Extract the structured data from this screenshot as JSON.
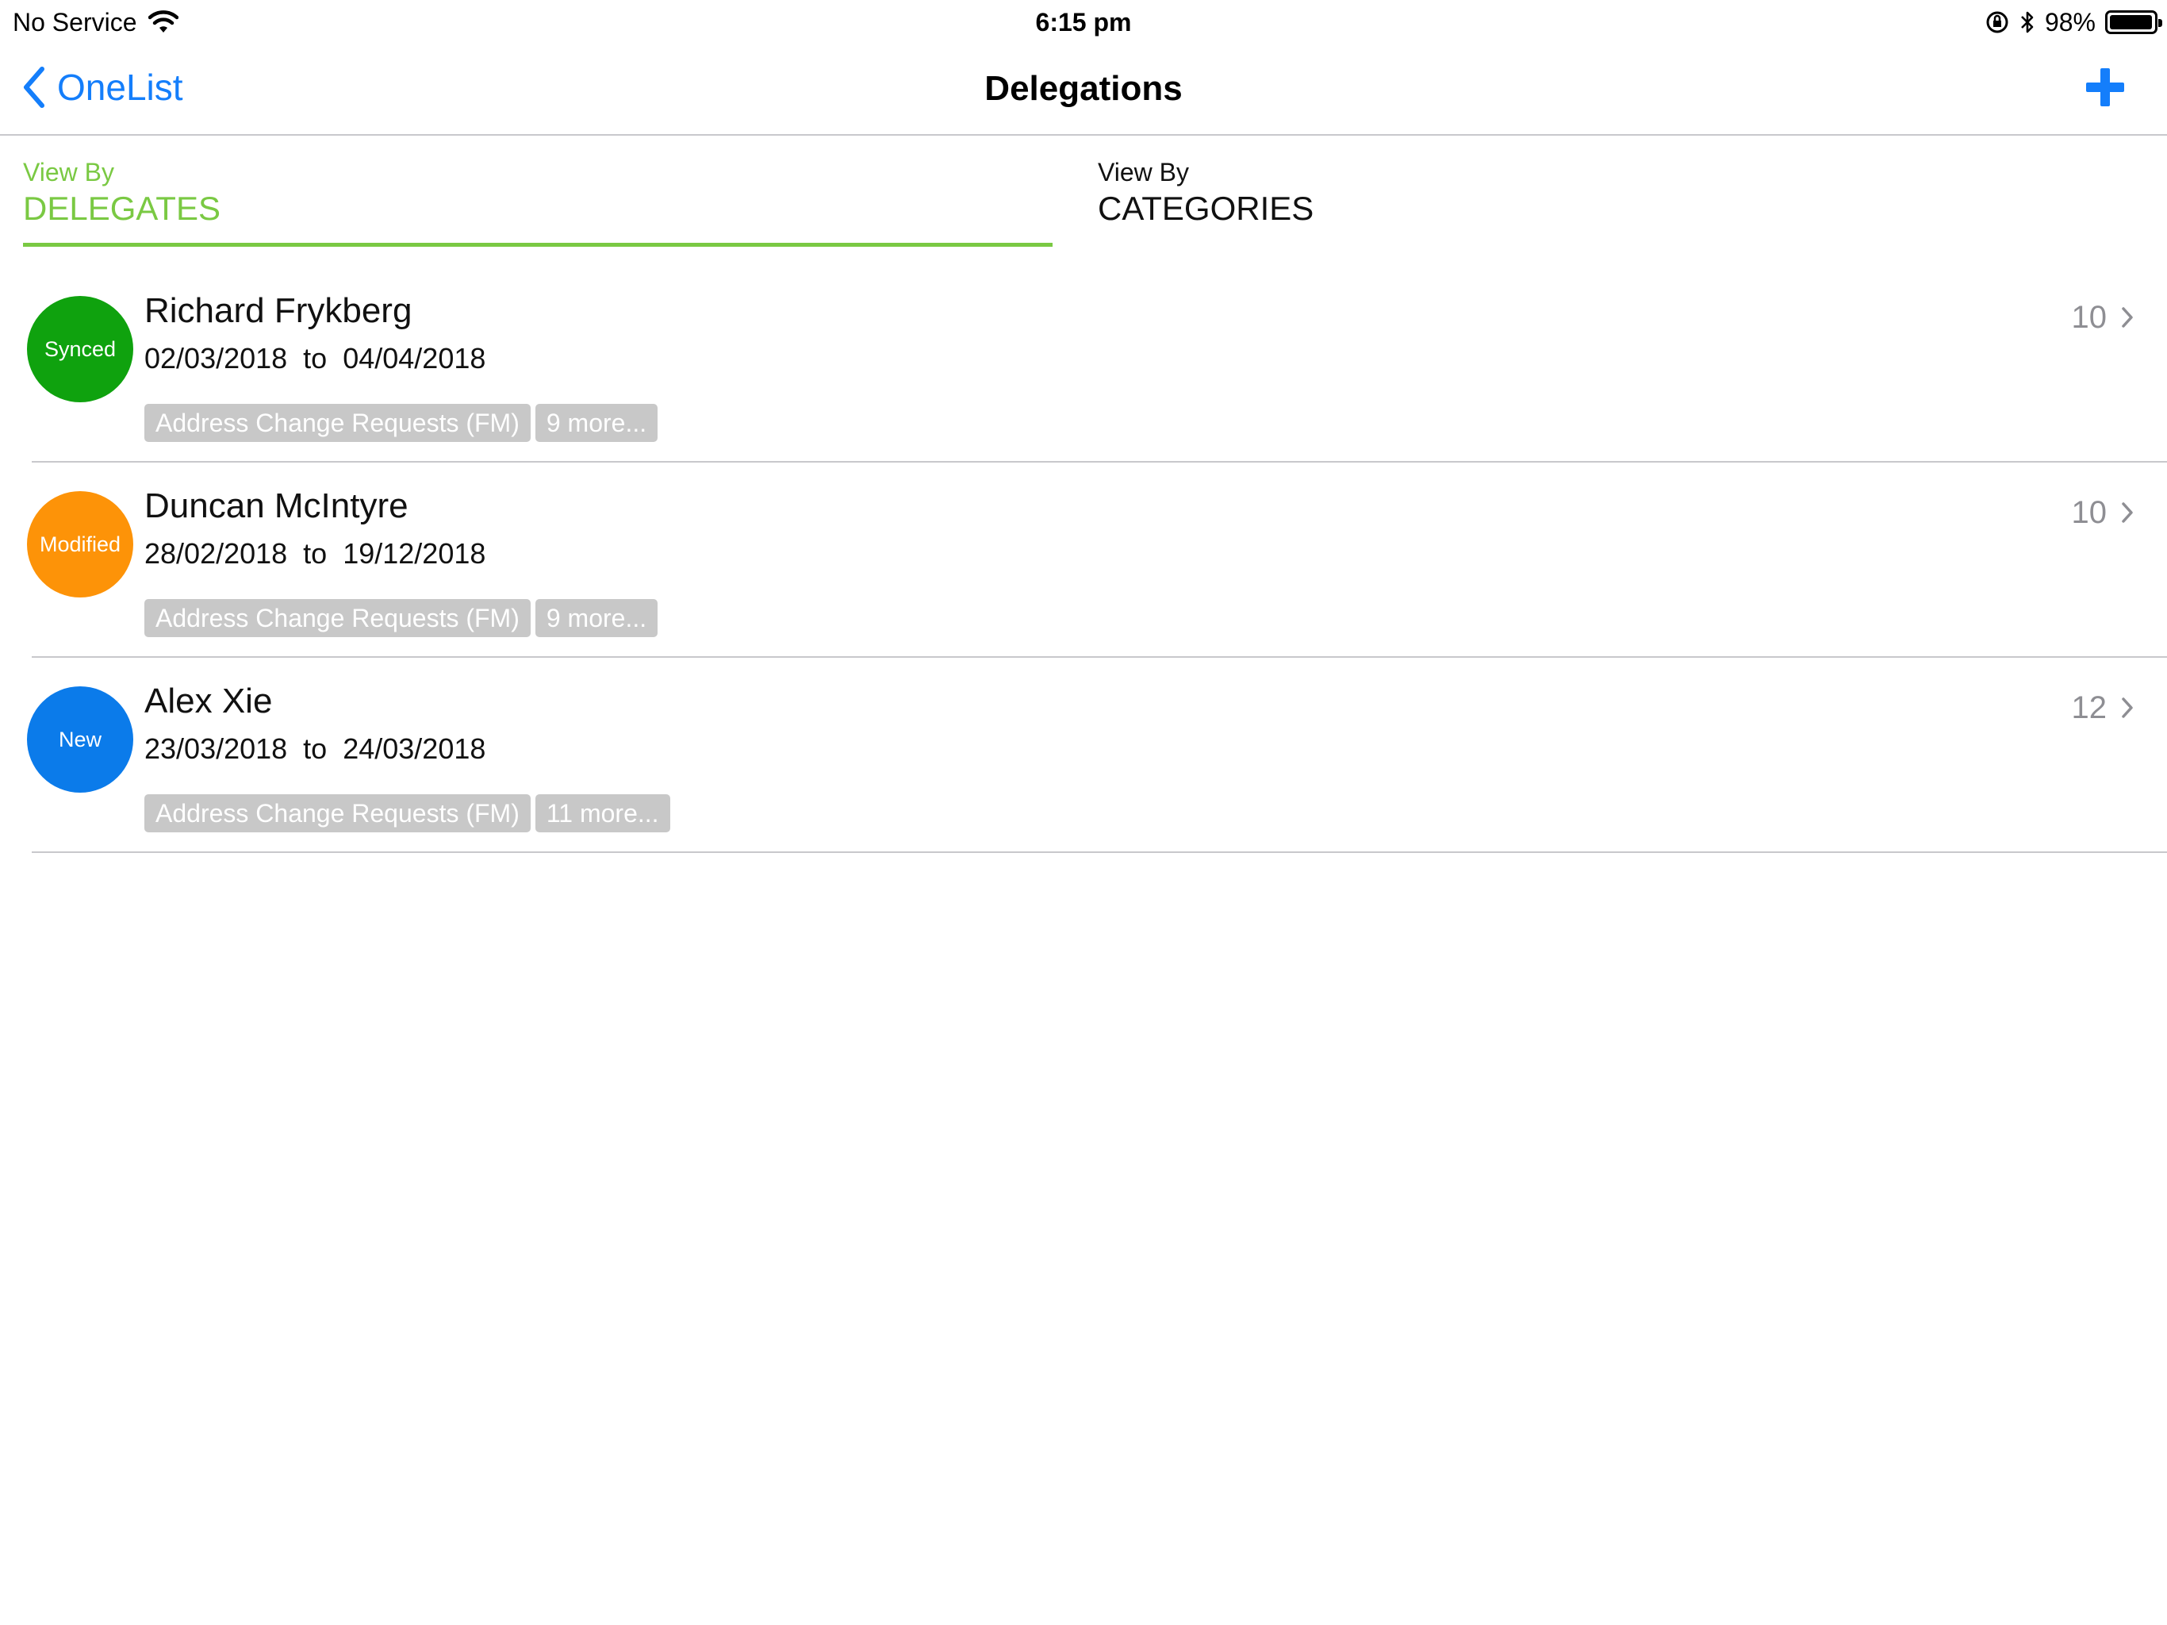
{
  "status_bar": {
    "carrier": "No Service",
    "time": "6:15 pm",
    "battery": "98%",
    "battery_level": 0.98
  },
  "nav": {
    "back_label": "OneList",
    "title": "Delegations"
  },
  "tabs": [
    {
      "kicker": "View By",
      "label": "DELEGATES",
      "active": true
    },
    {
      "kicker": "View By",
      "label": "CATEGORIES",
      "active": false
    }
  ],
  "delegations": [
    {
      "status": "Synced",
      "status_color": "#0fa20e",
      "name": "Richard Frykberg",
      "dates": "02/03/2018  to  04/04/2018",
      "tag": "Address Change Requests (FM)",
      "more": "9 more...",
      "count": "10"
    },
    {
      "status": "Modified",
      "status_color": "#fd9308",
      "name": "Duncan McIntyre",
      "dates": "28/02/2018  to  19/12/2018",
      "tag": "Address Change Requests (FM)",
      "more": "9 more...",
      "count": "10"
    },
    {
      "status": "New",
      "status_color": "#0b7bea",
      "name": "Alex Xie",
      "dates": "23/03/2018  to  24/03/2018",
      "tag": "Address Change Requests (FM)",
      "more": "11 more...",
      "count": "12"
    }
  ],
  "colors": {
    "accent": "#147efb",
    "tab_active": "#7ac943",
    "tag_bg": "#c8c8c8"
  },
  "icons": {
    "wifi": "wifi-icon",
    "orientation_lock": "orientation-lock-icon",
    "bluetooth": "bluetooth-icon",
    "battery": "battery-icon",
    "back": "chevron-left-icon",
    "add": "plus-icon",
    "row_disclosure": "chevron-right-icon"
  }
}
